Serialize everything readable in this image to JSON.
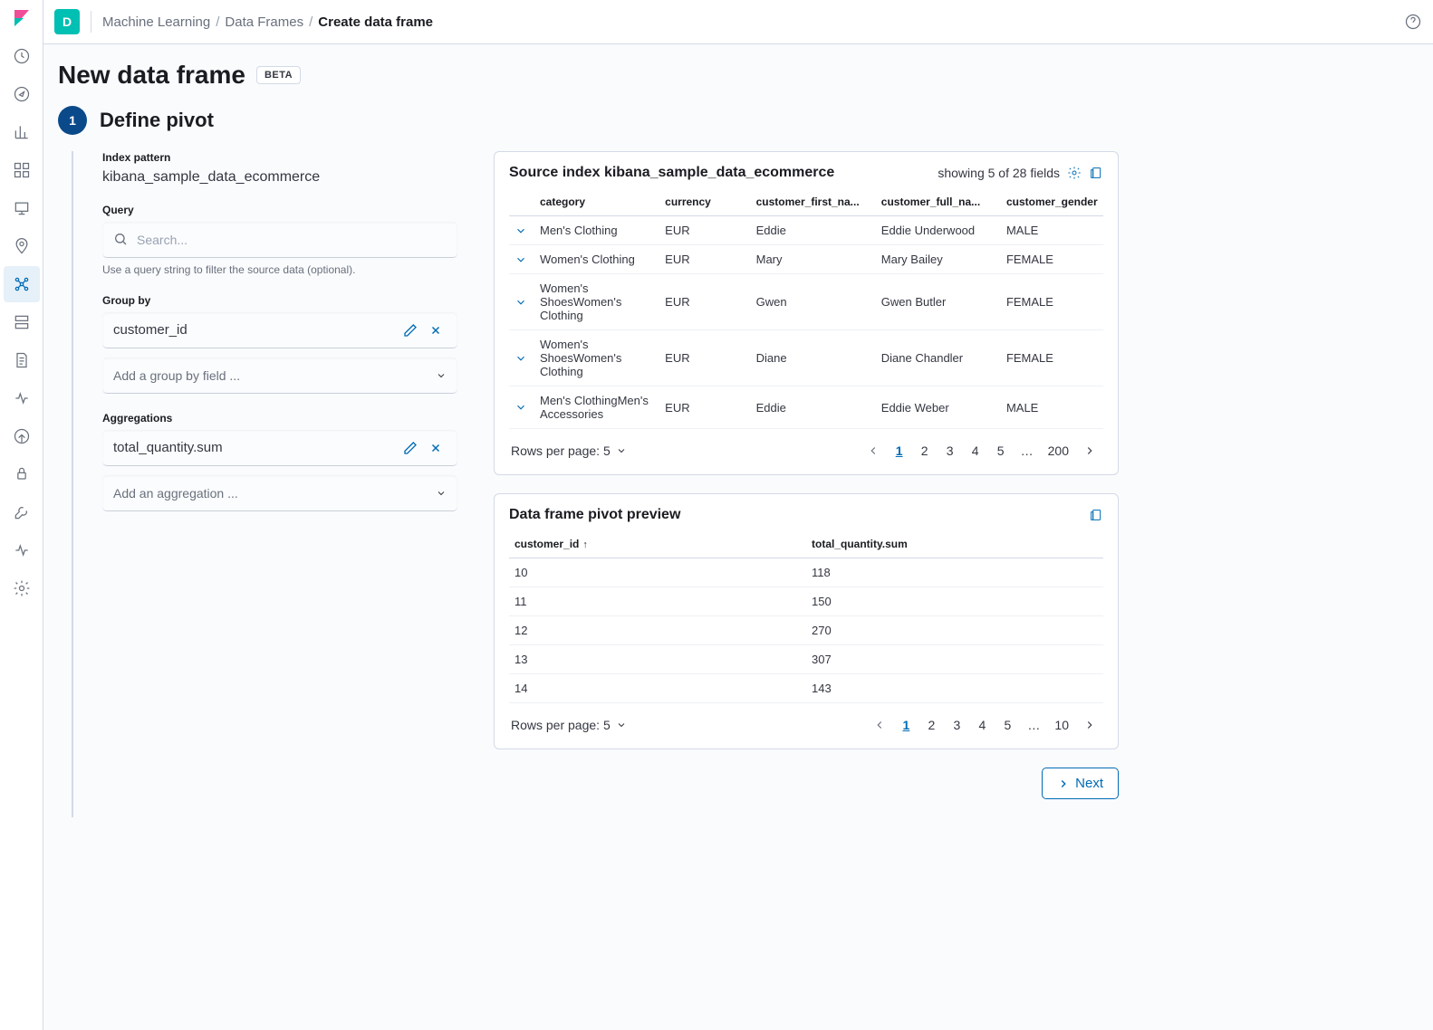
{
  "space_letter": "D",
  "breadcrumbs": [
    "Machine Learning",
    "Data Frames",
    "Create data frame"
  ],
  "page_title": "New data frame",
  "badge": "BETA",
  "step": {
    "number": "1",
    "title": "Define pivot"
  },
  "form": {
    "index_pattern_label": "Index pattern",
    "index_pattern_value": "kibana_sample_data_ecommerce",
    "query_label": "Query",
    "query_placeholder": "Search...",
    "query_hint": "Use a query string to filter the source data (optional).",
    "group_by_label": "Group by",
    "group_by_value": "customer_id",
    "group_by_placeholder": "Add a group by field ...",
    "aggregations_label": "Aggregations",
    "aggregations_value": "total_quantity.sum",
    "aggregations_placeholder": "Add an aggregation ..."
  },
  "source_panel": {
    "title_prefix": "Source index",
    "title_index": "kibana_sample_data_ecommerce",
    "showing_text": "showing 5 of 28 fields",
    "columns": [
      "category",
      "currency",
      "customer_first_na...",
      "customer_full_na...",
      "customer_gender"
    ],
    "rows": [
      {
        "category": "Men's Clothing",
        "currency": "EUR",
        "first": "Eddie",
        "full": "Eddie Underwood",
        "gender": "MALE"
      },
      {
        "category": "Women's Clothing",
        "currency": "EUR",
        "first": "Mary",
        "full": "Mary Bailey",
        "gender": "FEMALE"
      },
      {
        "category": "Women's ShoesWomen's Clothing",
        "currency": "EUR",
        "first": "Gwen",
        "full": "Gwen Butler",
        "gender": "FEMALE"
      },
      {
        "category": "Women's ShoesWomen's Clothing",
        "currency": "EUR",
        "first": "Diane",
        "full": "Diane Chandler",
        "gender": "FEMALE"
      },
      {
        "category": "Men's ClothingMen's Accessories",
        "currency": "EUR",
        "first": "Eddie",
        "full": "Eddie Weber",
        "gender": "MALE"
      }
    ],
    "rows_per_page_label": "Rows per page: 5",
    "pages": [
      "1",
      "2",
      "3",
      "4",
      "5",
      "…",
      "200"
    ]
  },
  "preview_panel": {
    "title": "Data frame pivot preview",
    "columns": [
      "customer_id",
      "total_quantity.sum"
    ],
    "rows": [
      {
        "id": "10",
        "sum": "118"
      },
      {
        "id": "11",
        "sum": "150"
      },
      {
        "id": "12",
        "sum": "270"
      },
      {
        "id": "13",
        "sum": "307"
      },
      {
        "id": "14",
        "sum": "143"
      }
    ],
    "rows_per_page_label": "Rows per page: 5",
    "pages": [
      "1",
      "2",
      "3",
      "4",
      "5",
      "…",
      "10"
    ]
  },
  "next_button": "Next"
}
